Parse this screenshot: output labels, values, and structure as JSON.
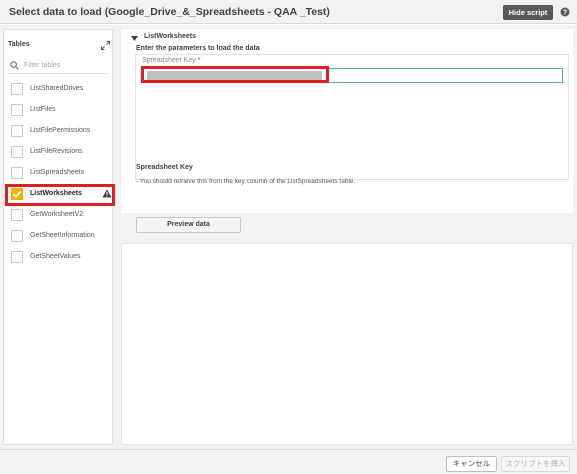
{
  "header": {
    "title": "Select data to load (Google_Drive_&_Spreadsheets - QAA _Test)",
    "hide_script_label": "Hide script",
    "help_icon": "help-circle-icon"
  },
  "tables_panel": {
    "heading": "Tables",
    "filter_placeholder": "Filter tables",
    "items": [
      {
        "label": "ListSharedDrives",
        "checked": false
      },
      {
        "label": "ListFiles",
        "checked": false
      },
      {
        "label": "ListFilePermissions",
        "checked": false
      },
      {
        "label": "ListFileRevisions",
        "checked": false
      },
      {
        "label": "ListSpreadsheets",
        "checked": false
      },
      {
        "label": "ListWorksheets",
        "checked": true,
        "warning": true
      },
      {
        "label": "GetWorksheetV2",
        "checked": false
      },
      {
        "label": "GetSheetInformation",
        "checked": false
      },
      {
        "label": "GetSheetValues",
        "checked": false
      }
    ]
  },
  "params": {
    "section_title": "ListWorksheets",
    "sub_heading": "Enter the parameters to load the data",
    "field_label": "Spreadsheet Key",
    "required_mark": "*",
    "help_title": "Spreadsheet Key",
    "help_text": "- You should retrieve this from the key column of the ListSpreadsheets table.",
    "preview_label": "Preview data"
  },
  "footer": {
    "cancel_label": "キャンセル",
    "insert_label": "スクリプトを挿入"
  },
  "colors": {
    "accent_yellow": "#f5b400",
    "highlight_red": "#e02020",
    "input_focus_blue": "#5aa7d6",
    "dark_button": "#595959"
  }
}
